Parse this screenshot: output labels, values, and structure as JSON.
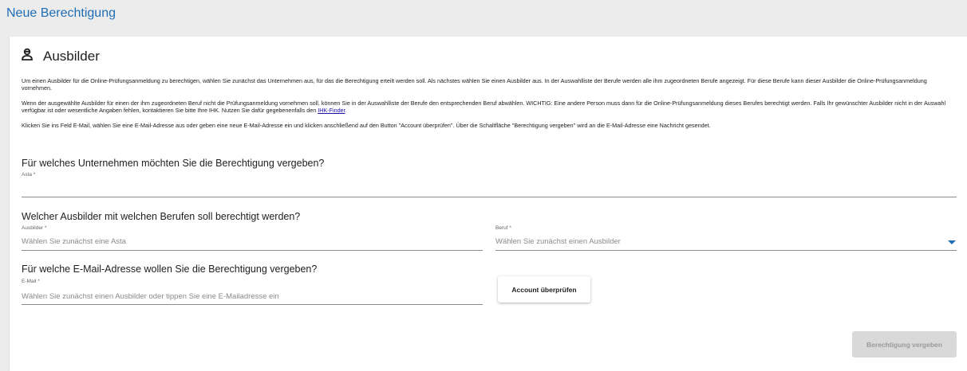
{
  "header": {
    "title": "Neue Berechtigung"
  },
  "section": {
    "title": "Ausbilder",
    "icon": "trainer-person-icon"
  },
  "paragraphs": {
    "p1": "Um einen Ausbilder für die Online-Prüfungsanmeldung zu berechtigen, wählen Sie zunächst das Unternehmen aus, für das die Berechtigung erteilt werden soll. Als nächstes wählen Sie einen Ausbilder aus. In der Auswahlliste der Berufe werden alle ihm zugeordneten Berufe angezeigt. Für diese Berufe kann dieser Ausbilder die Online-Prüfungsanmeldung vornehmen.",
    "p2": "Wenn der ausgewählte Ausbilder für einen der ihm zugeordneten Beruf nicht die Prüfungsanmeldung vornehmen soll, können Sie in der Auswahlliste der Berufe den entsprechenden Beruf abwählen. WICHTIG: Eine andere Person muss dann für die Online-Prüfungsanmeldung dieses Berufes berechtigt werden. Falls Ihr gewünschter Ausbilder nicht in der Auswahl verfügbar ist oder wesentliche Angaben fehlen, kontaktieren Sie bitte Ihre IHK. Nutzen Sie dafür gegebenenfalls den ",
    "p2_link": "IHK-Finder",
    "p2_end": ".",
    "p3": "Klicken Sie ins Feld E-Mail, wählen Sie eine E-Mail-Adresse aus oder geben eine neue E-Mail-Adresse ein und klicken anschließend auf den Button \"Account überprüfen\". Über die Schaltfläche \"Berechtigung vergeben\" wird an die E-Mail-Adresse eine Nachricht gesendet."
  },
  "company": {
    "question": "Für welches Unternehmen möchten Sie die Berechtigung vergeben?",
    "asta_label": "Asta *",
    "asta_value": ""
  },
  "trainer": {
    "question": "Welcher Ausbilder mit welchen Berufen soll berechtigt werden?",
    "ausbilder_label": "Ausbilder *",
    "ausbilder_placeholder": "Wählen Sie zunächst eine Asta",
    "beruf_label": "Beruf *",
    "beruf_placeholder": "Wählen Sie zunächst einen Ausbilder"
  },
  "email": {
    "question": "Für welche E-Mail-Adresse wollen Sie die Berechtigung vergeben?",
    "label": "E-Mail *",
    "placeholder": "Wählen Sie zunächst einen Ausbilder oder tippen Sie eine E-Mailadresse ein",
    "account_button": "Account überprüfen"
  },
  "actions": {
    "submit_label": "Berechtigung vergeben"
  },
  "colors": {
    "accent": "#1f6eb5",
    "disabled_bg": "#d9d9d9",
    "link": "#1a0dab"
  }
}
